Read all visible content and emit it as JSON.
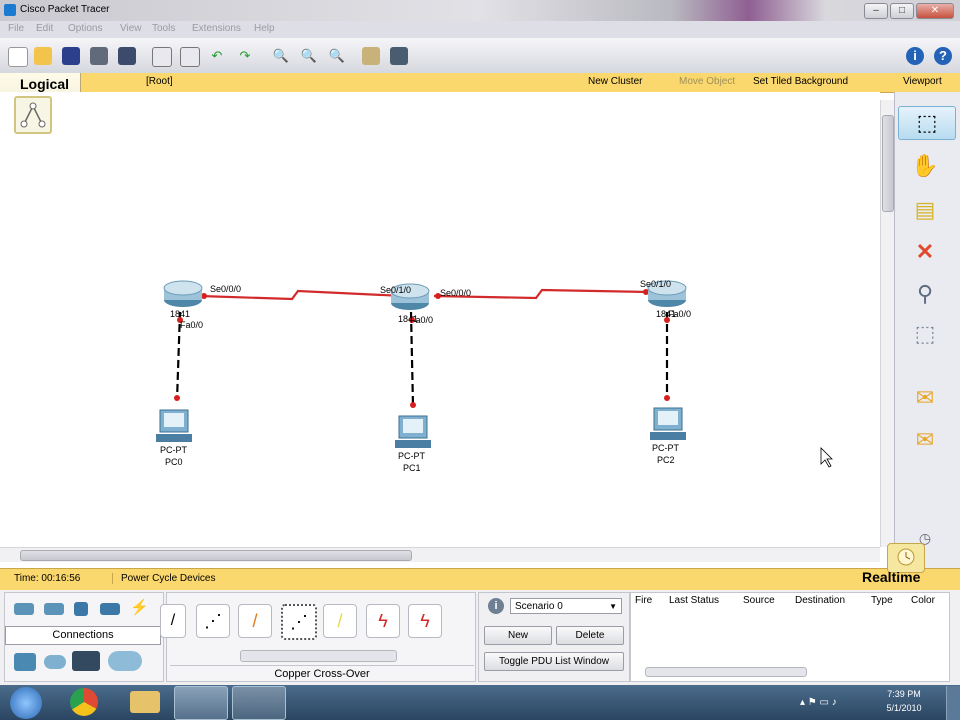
{
  "window": {
    "title": "Cisco Packet Tracer"
  },
  "menu": {
    "items": [
      "File",
      "Edit",
      "Options",
      "View",
      "Tools",
      "Extensions",
      "Help"
    ]
  },
  "workspace_bar": {
    "mode_label": "Logical",
    "root_label": "[Root]",
    "new_cluster": "New Cluster",
    "move_object": "Move Object",
    "set_tiled_background": "Set Tiled Background",
    "viewport": "Viewport"
  },
  "topology": {
    "routers": [
      {
        "model": "1841",
        "top_port": "Se0/0/0",
        "bottom_port": "Fa0/0"
      },
      {
        "model": "1841",
        "left_port": "Se0/1/0",
        "right_port": "Se0/0/0",
        "bottom_port": "Fa0/0"
      },
      {
        "model": "1841",
        "left_port": "Se0/1/0",
        "bottom_port": "Fa0/0"
      }
    ],
    "pcs": [
      {
        "type": "PC-PT",
        "name": "PC0"
      },
      {
        "type": "PC-PT",
        "name": "PC1"
      },
      {
        "type": "PC-PT",
        "name": "PC2"
      }
    ],
    "colors": {
      "serial_link": "#d22a2a",
      "lan_link": "#000000",
      "port_dot": "#d61f1f"
    }
  },
  "status": {
    "time": "Time: 00:16:56",
    "power_cycle": "Power Cycle Devices",
    "realtime": "Realtime"
  },
  "connections": {
    "label": "Connections",
    "selected_cable": "Copper Cross-Over"
  },
  "scenario": {
    "selected": "Scenario 0",
    "new_label": "New",
    "delete_label": "Delete",
    "toggle_label": "Toggle PDU List Window"
  },
  "pdu_table": {
    "columns": [
      "Fire",
      "Last Status",
      "Source",
      "Destination",
      "Type",
      "Color"
    ]
  },
  "taskbar": {
    "time": "7:39 PM",
    "date": "5/1/2010"
  }
}
